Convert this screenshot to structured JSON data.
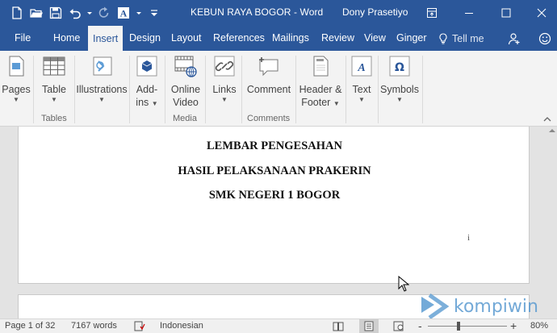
{
  "window": {
    "title": "KEBUN RAYA BOGOR  -  Word",
    "user": "Dony Prasetiyo",
    "colors": {
      "brand": "#2b579a",
      "ribbon": "#f3f3f3",
      "page": "#ffffff",
      "watermark": "#5b9bd1"
    }
  },
  "qat": {
    "icons": [
      "new-document-icon",
      "open-folder-icon",
      "save-icon",
      "undo-icon",
      "redo-icon",
      "font-color-icon",
      "customize-qat-icon"
    ]
  },
  "tabs": [
    {
      "label": "File"
    },
    {
      "label": "Home"
    },
    {
      "label": "Insert",
      "active": true
    },
    {
      "label": "Design"
    },
    {
      "label": "Layout"
    },
    {
      "label": "References"
    },
    {
      "label": "Mailings"
    },
    {
      "label": "Review"
    },
    {
      "label": "View"
    },
    {
      "label": "Ginger"
    }
  ],
  "tellme": {
    "label": "Tell me"
  },
  "ribbon": {
    "buttons": [
      {
        "label": "Pages"
      },
      {
        "label": "Table"
      },
      {
        "label": "Illustrations"
      },
      {
        "label": "Add-",
        "label2": "ins"
      },
      {
        "label": "Online",
        "label2": "Video"
      },
      {
        "label": "Links"
      },
      {
        "label": "Comment"
      },
      {
        "label": "Header &",
        "label2": "Footer"
      },
      {
        "label": "Text"
      },
      {
        "label": "Symbols"
      }
    ],
    "groups": {
      "tables": "Tables",
      "media": "Media",
      "comments": "Comments"
    }
  },
  "document": {
    "lines": [
      "LEMBAR PENGESAHAN",
      "HASIL PELAKSANAAN PRAKERIN",
      "SMK NEGERI 1 BOGOR"
    ],
    "cursor_glyph": "i"
  },
  "watermark": {
    "text": "kompiwin"
  },
  "status": {
    "page": "Page 1 of 32",
    "words": "7167 words",
    "language": "Indonesian",
    "zoom_minus": "-",
    "zoom_plus": "+",
    "zoom": "80%",
    "zoom_level": 0.8
  }
}
